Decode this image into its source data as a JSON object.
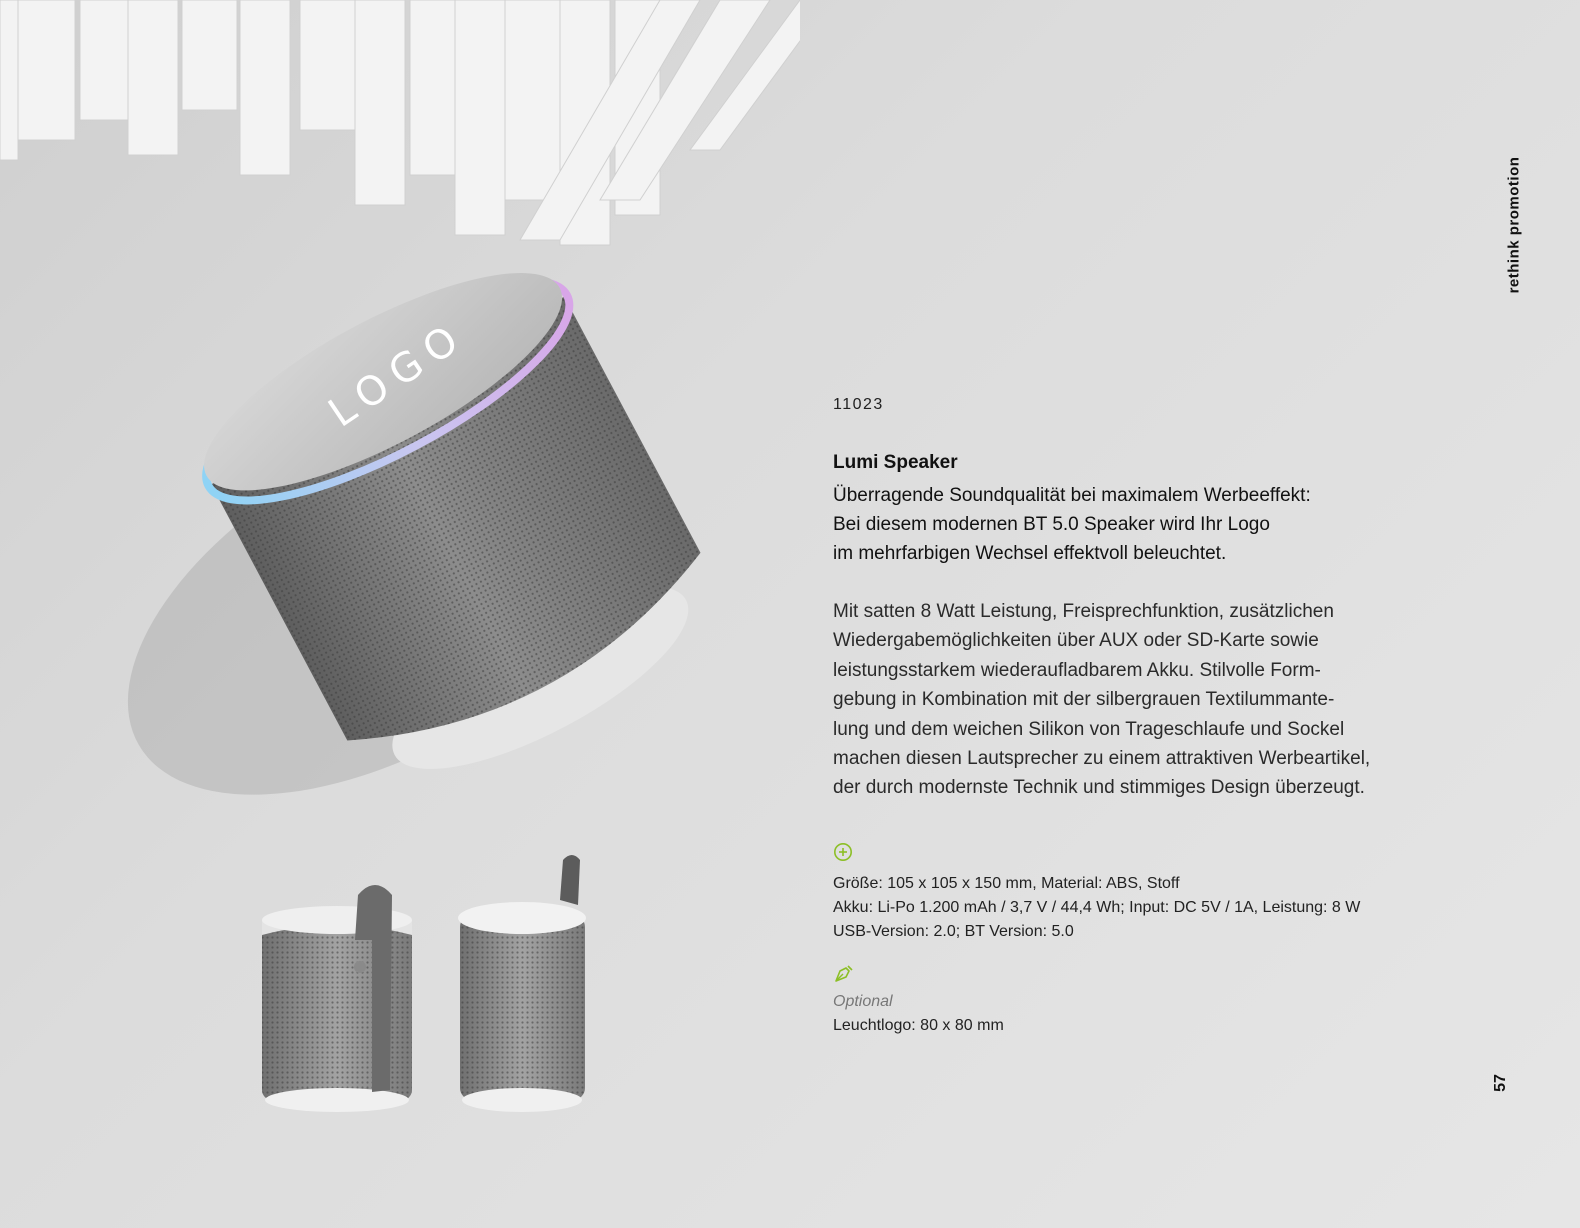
{
  "brand": "rethink promotion",
  "page_number": "57",
  "product": {
    "article_number": "11023",
    "title": "Lumi Speaker",
    "subtitle": "Überragende Soundqualität bei maximalem Werbeeffekt:\nBei diesem modernen BT 5.0 Speaker wird Ihr Logo\nim mehrfarbigen Wechsel effektvoll beleuchtet.",
    "description": "Mit satten 8 Watt Leistung, Freisprechfunktion, zusätzlichen\nWiedergabemöglichkeiten über AUX oder SD-Karte sowie\nleistungsstarkem wiederaufladbarem Akku. Stilvolle Form-\ngebung in Kombination mit der silbergrauen Textilummante-\nlung und dem weichen Silikon von Trageschlaufe und Sockel\nmachen diesen Lautsprecher zu einem attraktiven Werbeartikel,\nder durch modernste Technik und stimmiges Design überzeugt.",
    "specs": "Größe: 105 x 105 x 150 mm, Material: ABS, Stoff\nAkku: Li-Po 1.200 mAh / 3,7 V / 44,4 Wh; Input: DC 5V / 1A, Leistung: 8 W\nUSB-Version: 2.0; BT Version: 5.0",
    "optional_label": "Optional",
    "optional_value": "Leuchtlogo: 80 x 80 mm",
    "logo_text": "LOGO"
  },
  "icons": {
    "specs": "plus-circle-icon",
    "optional": "pen-nib-icon"
  },
  "colors": {
    "accent_green": "#8cbf26",
    "text_dark": "#111111",
    "text_muted": "#777777"
  }
}
